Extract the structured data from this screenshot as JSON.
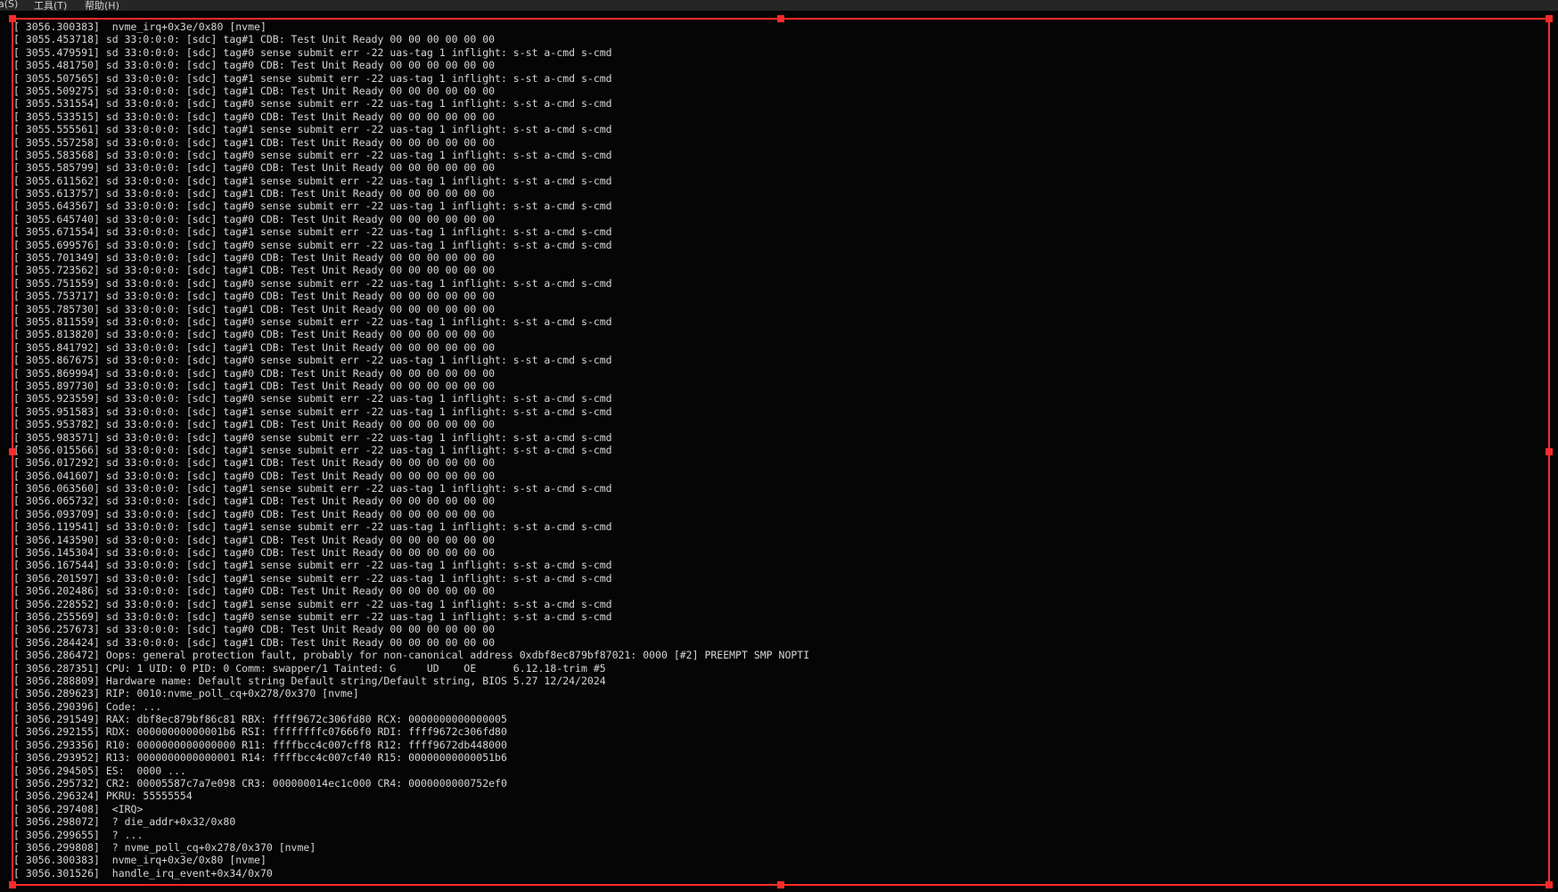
{
  "menubar": {
    "items": [
      "a(S)",
      "工具(T)",
      "帮助(H)"
    ]
  },
  "colors": {
    "selection_border": "#ff2a2a",
    "console_text": "#d6d6d6",
    "background": "#050505"
  },
  "console": {
    "lines": [
      "[ 3056.300383]  nvme_irq+0x3e/0x80 [nvme]",
      "[ 3055.453718] sd 33:0:0:0: [sdc] tag#1 CDB: Test Unit Ready 00 00 00 00 00 00",
      "[ 3055.479591] sd 33:0:0:0: [sdc] tag#0 sense submit err -22 uas-tag 1 inflight: s-st a-cmd s-cmd",
      "[ 3055.481750] sd 33:0:0:0: [sdc] tag#0 CDB: Test Unit Ready 00 00 00 00 00 00",
      "[ 3055.507565] sd 33:0:0:0: [sdc] tag#1 sense submit err -22 uas-tag 1 inflight: s-st a-cmd s-cmd",
      "[ 3055.509275] sd 33:0:0:0: [sdc] tag#1 CDB: Test Unit Ready 00 00 00 00 00 00",
      "[ 3055.531554] sd 33:0:0:0: [sdc] tag#0 sense submit err -22 uas-tag 1 inflight: s-st a-cmd s-cmd",
      "[ 3055.533515] sd 33:0:0:0: [sdc] tag#0 CDB: Test Unit Ready 00 00 00 00 00 00",
      "[ 3055.555561] sd 33:0:0:0: [sdc] tag#1 sense submit err -22 uas-tag 1 inflight: s-st a-cmd s-cmd",
      "[ 3055.557258] sd 33:0:0:0: [sdc] tag#1 CDB: Test Unit Ready 00 00 00 00 00 00",
      "[ 3055.583568] sd 33:0:0:0: [sdc] tag#0 sense submit err -22 uas-tag 1 inflight: s-st a-cmd s-cmd",
      "[ 3055.585799] sd 33:0:0:0: [sdc] tag#0 CDB: Test Unit Ready 00 00 00 00 00 00",
      "[ 3055.611562] sd 33:0:0:0: [sdc] tag#1 sense submit err -22 uas-tag 1 inflight: s-st a-cmd s-cmd",
      "[ 3055.613757] sd 33:0:0:0: [sdc] tag#1 CDB: Test Unit Ready 00 00 00 00 00 00",
      "[ 3055.643567] sd 33:0:0:0: [sdc] tag#0 sense submit err -22 uas-tag 1 inflight: s-st a-cmd s-cmd",
      "[ 3055.645740] sd 33:0:0:0: [sdc] tag#0 CDB: Test Unit Ready 00 00 00 00 00 00",
      "[ 3055.671554] sd 33:0:0:0: [sdc] tag#1 sense submit err -22 uas-tag 1 inflight: s-st a-cmd s-cmd",
      "[ 3055.699576] sd 33:0:0:0: [sdc] tag#0 sense submit err -22 uas-tag 1 inflight: s-st a-cmd s-cmd",
      "[ 3055.701349] sd 33:0:0:0: [sdc] tag#0 CDB: Test Unit Ready 00 00 00 00 00 00",
      "[ 3055.723562] sd 33:0:0:0: [sdc] tag#1 CDB: Test Unit Ready 00 00 00 00 00 00",
      "[ 3055.751559] sd 33:0:0:0: [sdc] tag#0 sense submit err -22 uas-tag 1 inflight: s-st a-cmd s-cmd",
      "[ 3055.753717] sd 33:0:0:0: [sdc] tag#0 CDB: Test Unit Ready 00 00 00 00 00 00",
      "[ 3055.785730] sd 33:0:0:0: [sdc] tag#1 CDB: Test Unit Ready 00 00 00 00 00 00",
      "[ 3055.811559] sd 33:0:0:0: [sdc] tag#0 sense submit err -22 uas-tag 1 inflight: s-st a-cmd s-cmd",
      "[ 3055.813820] sd 33:0:0:0: [sdc] tag#0 CDB: Test Unit Ready 00 00 00 00 00 00",
      "[ 3055.841792] sd 33:0:0:0: [sdc] tag#1 CDB: Test Unit Ready 00 00 00 00 00 00",
      "[ 3055.867675] sd 33:0:0:0: [sdc] tag#0 sense submit err -22 uas-tag 1 inflight: s-st a-cmd s-cmd",
      "[ 3055.869994] sd 33:0:0:0: [sdc] tag#0 CDB: Test Unit Ready 00 00 00 00 00 00",
      "[ 3055.897730] sd 33:0:0:0: [sdc] tag#1 CDB: Test Unit Ready 00 00 00 00 00 00",
      "[ 3055.923559] sd 33:0:0:0: [sdc] tag#0 sense submit err -22 uas-tag 1 inflight: s-st a-cmd s-cmd",
      "[ 3055.951583] sd 33:0:0:0: [sdc] tag#1 sense submit err -22 uas-tag 1 inflight: s-st a-cmd s-cmd",
      "[ 3055.953782] sd 33:0:0:0: [sdc] tag#1 CDB: Test Unit Ready 00 00 00 00 00 00",
      "[ 3055.983571] sd 33:0:0:0: [sdc] tag#0 sense submit err -22 uas-tag 1 inflight: s-st a-cmd s-cmd",
      "[ 3056.015566] sd 33:0:0:0: [sdc] tag#1 sense submit err -22 uas-tag 1 inflight: s-st a-cmd s-cmd",
      "[ 3056.017292] sd 33:0:0:0: [sdc] tag#1 CDB: Test Unit Ready 00 00 00 00 00 00",
      "[ 3056.041607] sd 33:0:0:0: [sdc] tag#0 CDB: Test Unit Ready 00 00 00 00 00 00",
      "[ 3056.063560] sd 33:0:0:0: [sdc] tag#1 sense submit err -22 uas-tag 1 inflight: s-st a-cmd s-cmd",
      "[ 3056.065732] sd 33:0:0:0: [sdc] tag#1 CDB: Test Unit Ready 00 00 00 00 00 00",
      "[ 3056.093709] sd 33:0:0:0: [sdc] tag#0 CDB: Test Unit Ready 00 00 00 00 00 00",
      "[ 3056.119541] sd 33:0:0:0: [sdc] tag#1 sense submit err -22 uas-tag 1 inflight: s-st a-cmd s-cmd",
      "[ 3056.143590] sd 33:0:0:0: [sdc] tag#1 CDB: Test Unit Ready 00 00 00 00 00 00",
      "[ 3056.145304] sd 33:0:0:0: [sdc] tag#0 CDB: Test Unit Ready 00 00 00 00 00 00",
      "[ 3056.167544] sd 33:0:0:0: [sdc] tag#1 sense submit err -22 uas-tag 1 inflight: s-st a-cmd s-cmd",
      "[ 3056.201597] sd 33:0:0:0: [sdc] tag#1 sense submit err -22 uas-tag 1 inflight: s-st a-cmd s-cmd",
      "[ 3056.202486] sd 33:0:0:0: [sdc] tag#0 CDB: Test Unit Ready 00 00 00 00 00 00",
      "[ 3056.228552] sd 33:0:0:0: [sdc] tag#1 sense submit err -22 uas-tag 1 inflight: s-st a-cmd s-cmd",
      "[ 3056.255569] sd 33:0:0:0: [sdc] tag#0 sense submit err -22 uas-tag 1 inflight: s-st a-cmd s-cmd",
      "[ 3056.257673] sd 33:0:0:0: [sdc] tag#0 CDB: Test Unit Ready 00 00 00 00 00 00",
      "[ 3056.284424] sd 33:0:0:0: [sdc] tag#1 CDB: Test Unit Ready 00 00 00 00 00 00",
      "[ 3056.286472] Oops: general protection fault, probably for non-canonical address 0xdbf8ec879bf87021: 0000 [#2] PREEMPT SMP NOPTI",
      "[ 3056.287351] CPU: 1 UID: 0 PID: 0 Comm: swapper/1 Tainted: G     UD    OE      6.12.18-trim #5",
      "[ 3056.288809] Hardware name: Default string Default string/Default string, BIOS 5.27 12/24/2024",
      "[ 3056.289623] RIP: 0010:nvme_poll_cq+0x278/0x370 [nvme]",
      "[ 3056.290396] Code: ...",
      "[ 3056.291549] RAX: dbf8ec879bf86c81 RBX: ffff9672c306fd80 RCX: 0000000000000005",
      "[ 3056.292155] RDX: 00000000000001b6 RSI: ffffffffc07666f0 RDI: ffff9672c306fd80",
      "[ 3056.293356] R10: 0000000000000000 R11: ffffbcc4c007cff8 R12: ffff9672db448000",
      "[ 3056.293952] R13: 0000000000000001 R14: ffffbcc4c007cf40 R15: 00000000000051b6",
      "[ 3056.294505] ES:  0000 ...",
      "[ 3056.295732] CR2: 00005587c7a7e098 CR3: 000000014ec1c000 CR4: 0000000000752ef0",
      "[ 3056.296324] PKRU: 55555554",
      "[ 3056.297408]  <IRQ>",
      "[ 3056.298072]  ? die_addr+0x32/0x80",
      "[ 3056.299655]  ? ...",
      "[ 3056.299808]  ? nvme_poll_cq+0x278/0x370 [nvme]",
      "[ 3056.300383]  nvme_irq+0x3e/0x80 [nvme]",
      "[ 3056.301526]  handle_irq_event+0x34/0x70"
    ]
  }
}
